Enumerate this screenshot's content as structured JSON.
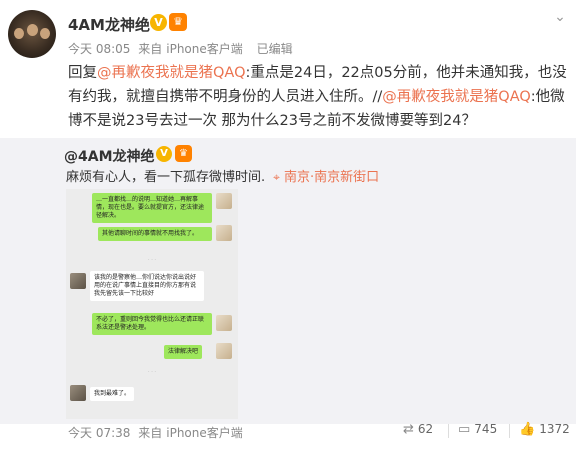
{
  "post": {
    "username": "4AM龙神绝",
    "verified_icon": "verified-v-icon",
    "vip_icon": "vip-crown-icon",
    "meta": {
      "time": "今天 08:05",
      "source_prefix": "来自",
      "source": "iPhone客户端",
      "edited": "已编辑"
    },
    "body": {
      "reply_prefix": "回复",
      "mention1": "@再歉夜我就是猪QAQ",
      "text1": ":重点是24日，22点05分前，他并未通知我，也没有约我，就擅自携带不明身份的人员进入住所。//",
      "mention2": "@再歉夜我就是猪QAQ",
      "text2": ":他微博不是说23号去过一次 那为什么23号之前不发微博要等到24？"
    }
  },
  "repost": {
    "username": "@4AM龙神绝",
    "text": "麻烦有心人，看一下孤存微博时间.",
    "location_icon": "location-pin-icon",
    "location": "南京·南京新街口",
    "chat": {
      "messages": [
        {
          "side": "me",
          "text": "…一直都找…的说明…知道她…再解事情，现在也是。要么就提官方，还法律途径解决。"
        },
        {
          "side": "me",
          "text": "其他请聊时间的事情就不用找我了。"
        },
        {
          "side": "other",
          "text": "该我的是警察他…你们说达你说出说好用的在说广事情上直接目的你方那有说我先留先该一下比较好"
        },
        {
          "side": "me",
          "text": "不必了，重则回今我觉得也比么还请正联系法还是警述处理。"
        },
        {
          "side": "me",
          "text": "法律解决吧"
        },
        {
          "side": "other",
          "text": "我到最难了。"
        }
      ]
    }
  },
  "footer": {
    "time": "今天 07:38",
    "source_prefix": "来自",
    "source": "iPhone客户端",
    "repost_count": "62",
    "comment_count": "745",
    "like_count": "1372"
  }
}
